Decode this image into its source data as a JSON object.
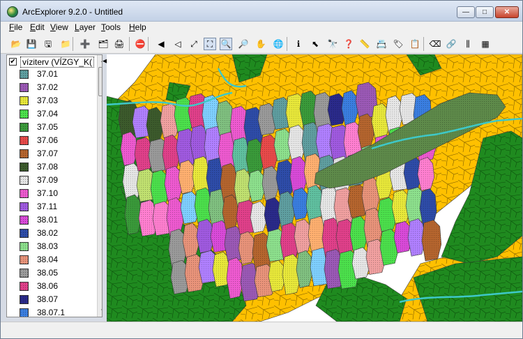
{
  "window": {
    "title": "ArcExplorer 9.2.0 - Untitled",
    "controls": {
      "minimize": "—",
      "maximize": "□",
      "close": "✕"
    }
  },
  "menu": [
    {
      "pre": "",
      "u": "F",
      "post": "ile"
    },
    {
      "pre": "",
      "u": "E",
      "post": "dit"
    },
    {
      "pre": "",
      "u": "V",
      "post": "iew"
    },
    {
      "pre": "",
      "u": "L",
      "post": "ayer"
    },
    {
      "pre": "",
      "u": "T",
      "post": "ools"
    },
    {
      "pre": "",
      "u": "H",
      "post": "elp"
    }
  ],
  "toolbar": [
    {
      "name": "open-icon",
      "glyph": "📂",
      "interactable": true
    },
    {
      "name": "save-icon",
      "glyph": "💾",
      "interactable": true
    },
    {
      "name": "save-all-icon",
      "glyph": "🖫",
      "interactable": true
    },
    {
      "name": "open-folder-icon",
      "glyph": "📁",
      "interactable": true
    },
    {
      "name": "add-layer-icon",
      "glyph": "➕",
      "interactable": true
    },
    {
      "name": "add-data-icon",
      "glyph": "🗂",
      "interactable": true
    },
    {
      "name": "print-icon",
      "glyph": "🖨",
      "interactable": true
    },
    {
      "name": "stop-icon",
      "glyph": "⛔",
      "interactable": true
    },
    {
      "name": "back-extent-icon",
      "glyph": "◀",
      "interactable": true
    },
    {
      "name": "forward-extent-icon",
      "glyph": "◁",
      "interactable": true
    },
    {
      "name": "zoom-layer-icon",
      "glyph": "⤢",
      "interactable": true
    },
    {
      "name": "full-extent-icon",
      "glyph": "⛶",
      "interactable": true,
      "pressed": true
    },
    {
      "name": "zoom-in-icon",
      "glyph": "🔍",
      "interactable": true,
      "pressed": true
    },
    {
      "name": "zoom-out-icon",
      "glyph": "🔎",
      "interactable": true
    },
    {
      "name": "pan-hand-icon",
      "glyph": "✋",
      "interactable": true
    },
    {
      "name": "globe-icon",
      "glyph": "🌐",
      "interactable": true
    },
    {
      "name": "identify-icon",
      "glyph": "ℹ",
      "interactable": true
    },
    {
      "name": "select-icon",
      "glyph": "⬉",
      "interactable": true
    },
    {
      "name": "find-icon",
      "glyph": "🔭",
      "interactable": true
    },
    {
      "name": "query-icon",
      "glyph": "❓",
      "interactable": true
    },
    {
      "name": "measure-icon",
      "glyph": "📏",
      "interactable": true
    },
    {
      "name": "attribute-icon",
      "glyph": "📇",
      "interactable": true
    },
    {
      "name": "label-icon",
      "glyph": "🏷",
      "interactable": true
    },
    {
      "name": "properties-icon",
      "glyph": "📋",
      "interactable": true
    },
    {
      "name": "eraser-icon",
      "glyph": "⌫",
      "interactable": true
    },
    {
      "name": "hyperlink-icon",
      "glyph": "🔗",
      "interactable": true
    },
    {
      "name": "graph-icon",
      "glyph": "⫼",
      "interactable": true
    },
    {
      "name": "table-icon",
      "glyph": "▦",
      "interactable": true
    }
  ],
  "toc": {
    "layer_name": "víziterv (VÍZGY_K(",
    "checked": "✔",
    "legend": [
      {
        "label": "37.01",
        "color": "#5f9ea0"
      },
      {
        "label": "37.02",
        "color": "#9b59b6"
      },
      {
        "label": "37.03",
        "color": "#e8e83a"
      },
      {
        "label": "37.04",
        "color": "#4ce04c"
      },
      {
        "label": "37.05",
        "color": "#3a9a3a"
      },
      {
        "label": "37.06",
        "color": "#e84a4a"
      },
      {
        "label": "37.07",
        "color": "#b5652e"
      },
      {
        "label": "37.08",
        "color": "#3c5a2c"
      },
      {
        "label": "37.09",
        "color": "#e6e6e6"
      },
      {
        "label": "37.10",
        "color": "#ee5ad0"
      },
      {
        "label": "37.11",
        "color": "#a05ae0"
      },
      {
        "label": "38.01",
        "color": "#d94ad9"
      },
      {
        "label": "38.02",
        "color": "#2e4ca8"
      },
      {
        "label": "38.03",
        "color": "#8de08d"
      },
      {
        "label": "38.04",
        "color": "#e8937a"
      },
      {
        "label": "38.05",
        "color": "#9a9a9a"
      },
      {
        "label": "38.06",
        "color": "#e0408a"
      },
      {
        "label": "38.07",
        "color": "#2a2a8a"
      },
      {
        "label": "38.07.1",
        "color": "#3a7ee0"
      }
    ],
    "scroll_up": "▲",
    "scroll_down": "▼"
  },
  "splitter_arrow": "◀",
  "map": {
    "colors": {
      "yellow": "#ffc000",
      "green": "#1f8a1f",
      "water": "#3ec8c8",
      "lake": "#5e8a4a",
      "lines": "#8a6a00"
    }
  }
}
